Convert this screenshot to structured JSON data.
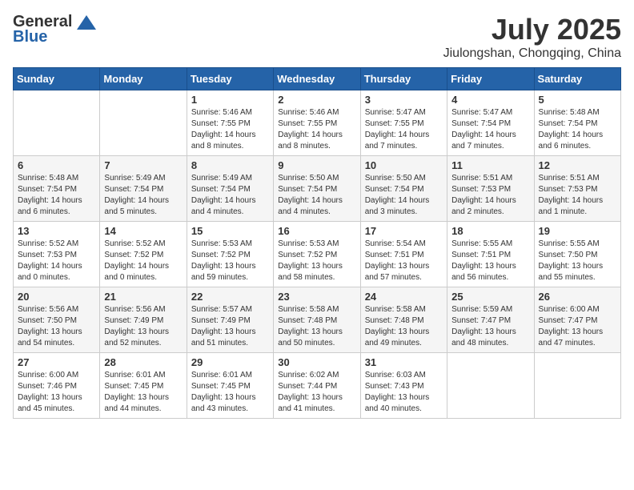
{
  "header": {
    "logo_general": "General",
    "logo_blue": "Blue",
    "month_year": "July 2025",
    "location": "Jiulongshan, Chongqing, China"
  },
  "weekdays": [
    "Sunday",
    "Monday",
    "Tuesday",
    "Wednesday",
    "Thursday",
    "Friday",
    "Saturday"
  ],
  "weeks": [
    [
      {
        "day": "",
        "info": ""
      },
      {
        "day": "",
        "info": ""
      },
      {
        "day": "1",
        "info": "Sunrise: 5:46 AM\nSunset: 7:55 PM\nDaylight: 14 hours and 8 minutes."
      },
      {
        "day": "2",
        "info": "Sunrise: 5:46 AM\nSunset: 7:55 PM\nDaylight: 14 hours and 8 minutes."
      },
      {
        "day": "3",
        "info": "Sunrise: 5:47 AM\nSunset: 7:55 PM\nDaylight: 14 hours and 7 minutes."
      },
      {
        "day": "4",
        "info": "Sunrise: 5:47 AM\nSunset: 7:54 PM\nDaylight: 14 hours and 7 minutes."
      },
      {
        "day": "5",
        "info": "Sunrise: 5:48 AM\nSunset: 7:54 PM\nDaylight: 14 hours and 6 minutes."
      }
    ],
    [
      {
        "day": "6",
        "info": "Sunrise: 5:48 AM\nSunset: 7:54 PM\nDaylight: 14 hours and 6 minutes."
      },
      {
        "day": "7",
        "info": "Sunrise: 5:49 AM\nSunset: 7:54 PM\nDaylight: 14 hours and 5 minutes."
      },
      {
        "day": "8",
        "info": "Sunrise: 5:49 AM\nSunset: 7:54 PM\nDaylight: 14 hours and 4 minutes."
      },
      {
        "day": "9",
        "info": "Sunrise: 5:50 AM\nSunset: 7:54 PM\nDaylight: 14 hours and 4 minutes."
      },
      {
        "day": "10",
        "info": "Sunrise: 5:50 AM\nSunset: 7:54 PM\nDaylight: 14 hours and 3 minutes."
      },
      {
        "day": "11",
        "info": "Sunrise: 5:51 AM\nSunset: 7:53 PM\nDaylight: 14 hours and 2 minutes."
      },
      {
        "day": "12",
        "info": "Sunrise: 5:51 AM\nSunset: 7:53 PM\nDaylight: 14 hours and 1 minute."
      }
    ],
    [
      {
        "day": "13",
        "info": "Sunrise: 5:52 AM\nSunset: 7:53 PM\nDaylight: 14 hours and 0 minutes."
      },
      {
        "day": "14",
        "info": "Sunrise: 5:52 AM\nSunset: 7:52 PM\nDaylight: 14 hours and 0 minutes."
      },
      {
        "day": "15",
        "info": "Sunrise: 5:53 AM\nSunset: 7:52 PM\nDaylight: 13 hours and 59 minutes."
      },
      {
        "day": "16",
        "info": "Sunrise: 5:53 AM\nSunset: 7:52 PM\nDaylight: 13 hours and 58 minutes."
      },
      {
        "day": "17",
        "info": "Sunrise: 5:54 AM\nSunset: 7:51 PM\nDaylight: 13 hours and 57 minutes."
      },
      {
        "day": "18",
        "info": "Sunrise: 5:55 AM\nSunset: 7:51 PM\nDaylight: 13 hours and 56 minutes."
      },
      {
        "day": "19",
        "info": "Sunrise: 5:55 AM\nSunset: 7:50 PM\nDaylight: 13 hours and 55 minutes."
      }
    ],
    [
      {
        "day": "20",
        "info": "Sunrise: 5:56 AM\nSunset: 7:50 PM\nDaylight: 13 hours and 54 minutes."
      },
      {
        "day": "21",
        "info": "Sunrise: 5:56 AM\nSunset: 7:49 PM\nDaylight: 13 hours and 52 minutes."
      },
      {
        "day": "22",
        "info": "Sunrise: 5:57 AM\nSunset: 7:49 PM\nDaylight: 13 hours and 51 minutes."
      },
      {
        "day": "23",
        "info": "Sunrise: 5:58 AM\nSunset: 7:48 PM\nDaylight: 13 hours and 50 minutes."
      },
      {
        "day": "24",
        "info": "Sunrise: 5:58 AM\nSunset: 7:48 PM\nDaylight: 13 hours and 49 minutes."
      },
      {
        "day": "25",
        "info": "Sunrise: 5:59 AM\nSunset: 7:47 PM\nDaylight: 13 hours and 48 minutes."
      },
      {
        "day": "26",
        "info": "Sunrise: 6:00 AM\nSunset: 7:47 PM\nDaylight: 13 hours and 47 minutes."
      }
    ],
    [
      {
        "day": "27",
        "info": "Sunrise: 6:00 AM\nSunset: 7:46 PM\nDaylight: 13 hours and 45 minutes."
      },
      {
        "day": "28",
        "info": "Sunrise: 6:01 AM\nSunset: 7:45 PM\nDaylight: 13 hours and 44 minutes."
      },
      {
        "day": "29",
        "info": "Sunrise: 6:01 AM\nSunset: 7:45 PM\nDaylight: 13 hours and 43 minutes."
      },
      {
        "day": "30",
        "info": "Sunrise: 6:02 AM\nSunset: 7:44 PM\nDaylight: 13 hours and 41 minutes."
      },
      {
        "day": "31",
        "info": "Sunrise: 6:03 AM\nSunset: 7:43 PM\nDaylight: 13 hours and 40 minutes."
      },
      {
        "day": "",
        "info": ""
      },
      {
        "day": "",
        "info": ""
      }
    ]
  ]
}
